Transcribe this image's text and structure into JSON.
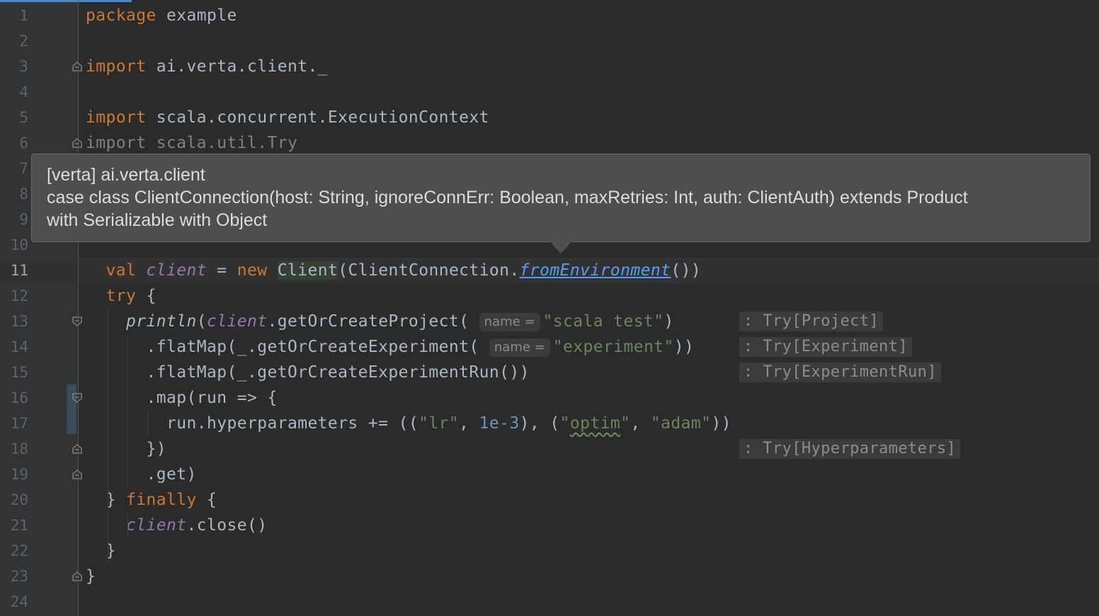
{
  "editor": {
    "lines": [
      {
        "n": "1",
        "html": "<span class='kw'>package</span> example"
      },
      {
        "n": "2",
        "html": ""
      },
      {
        "n": "3",
        "html": "<span class='kw'>import</span> ai.verta.client._"
      },
      {
        "n": "4",
        "html": ""
      },
      {
        "n": "5",
        "html": "<span class='kw'>import</span> scala.concurrent.ExecutionContext"
      },
      {
        "n": "6",
        "html": "<span class='unused'>import scala.util.Try</span>"
      },
      {
        "n": "7",
        "html": ""
      },
      {
        "n": "8",
        "html": ""
      },
      {
        "n": "9",
        "html": ""
      },
      {
        "n": "10",
        "html": ""
      },
      {
        "n": "11",
        "html": "  <span class='kw'>val</span> <span class='fld'>client</span> = <span class='kw'>new</span> <span class='hl'>Client</span>(ClientConnection.<span class='link'>fromEnvironment</span>())"
      },
      {
        "n": "12",
        "html": "  <span class='kw'>try</span> {"
      },
      {
        "n": "13",
        "html": "    <span class='ital'>println</span>(<span class='fld'>client</span>.getOrCreateProject( <span class='hint'>name =</span><span class='str'>\"scala test\"</span>)"
      },
      {
        "n": "14",
        "html": "      .flatMap(_.getOrCreateExperiment( <span class='hint'>name =</span><span class='str'>\"experiment\"</span>))"
      },
      {
        "n": "15",
        "html": "      .flatMap(_.getOrCreateExperimentRun())"
      },
      {
        "n": "16",
        "html": "      .map(run => {"
      },
      {
        "n": "17",
        "html": "        run.hyperparameters += ((<span class='str'>\"lr\"</span>, <span class='num'>1e-3</span>), (<span class='str'>\"<span class='squig'>optim</span>\"</span>, <span class='str'>\"adam\"</span>))"
      },
      {
        "n": "18",
        "html": "      })"
      },
      {
        "n": "19",
        "html": "      .get)"
      },
      {
        "n": "20",
        "html": "  } <span class='kw'>finally</span> {"
      },
      {
        "n": "21",
        "html": "    <span class='fld'>client</span>.close()"
      },
      {
        "n": "22",
        "html": "  }"
      },
      {
        "n": "23",
        "html": "}"
      },
      {
        "n": "24",
        "html": ""
      }
    ],
    "current_line": "11",
    "type_hints": {
      "line13": ": Try[Project]",
      "line14": ": Try[Experiment]",
      "line15": ": Try[ExperimentRun]",
      "line18": ": Try[Hyperparameters]"
    }
  },
  "tooltip": {
    "line1": "[verta] ai.verta.client",
    "line2": "case class ClientConnection(host: String, ignoreConnErr: Boolean, maxRetries: Int, auth: ClientAuth) extends Product",
    "line3": "with Serializable with Object"
  },
  "fold_markers": {
    "3": "end",
    "6": "end",
    "13": "start",
    "16": "start",
    "18": "end",
    "19": "end",
    "23": "end"
  },
  "colors": {
    "background": "#2b2b2b",
    "keyword": "#cc7832",
    "string": "#6a8759",
    "number": "#6897bb",
    "field": "#9876aa",
    "link": "#589df6"
  }
}
